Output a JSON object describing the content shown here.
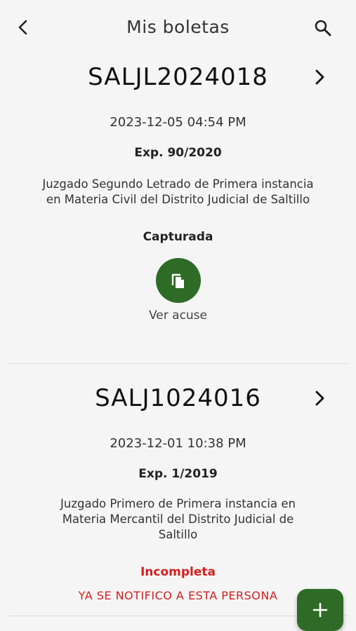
{
  "header": {
    "title": "Mis boletas",
    "back_icon": "arrow-back-icon",
    "search_icon": "search-icon"
  },
  "boletas": [
    {
      "folio": "SALJL2024018",
      "datetime": "2023-12-05 04:54 PM",
      "expediente": "Exp. 90/2020",
      "court_line1": "Juzgado Segundo Letrado de Primera instancia",
      "court_line2": "en Materia Civil del Distrito Judicial de Saltillo",
      "status": "Capturada",
      "status_color": "#222222",
      "acuse_label": "Ver acuse"
    },
    {
      "folio": "SALJ1024016",
      "datetime": "2023-12-01 10:38 PM",
      "expediente": "Exp. 1/2019",
      "court_line1": "Juzgado Primero de Primera instancia en",
      "court_line2": "Materia Mercantil del Distrito Judicial de",
      "court_line3": "Saltillo",
      "status": "Incompleta",
      "status_color": "#d32020",
      "notice": "YA SE NOTIFICO A ESTA PERSONA"
    }
  ],
  "fab_icon": "plus-icon",
  "colors": {
    "accent": "#2e6b27",
    "error": "#d32020",
    "background": "#f5f5f5"
  }
}
